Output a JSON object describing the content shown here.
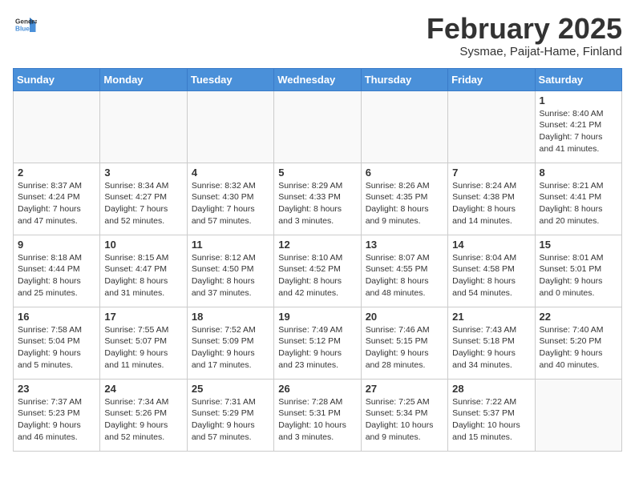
{
  "logo": {
    "general": "General",
    "blue": "Blue"
  },
  "header": {
    "title": "February 2025",
    "subtitle": "Sysmae, Paijat-Hame, Finland"
  },
  "weekdays": [
    "Sunday",
    "Monday",
    "Tuesday",
    "Wednesday",
    "Thursday",
    "Friday",
    "Saturday"
  ],
  "weeks": [
    [
      null,
      null,
      null,
      null,
      null,
      null,
      {
        "day": "1",
        "info": "Sunrise: 8:40 AM\nSunset: 4:21 PM\nDaylight: 7 hours and 41 minutes."
      }
    ],
    [
      {
        "day": "2",
        "info": "Sunrise: 8:37 AM\nSunset: 4:24 PM\nDaylight: 7 hours and 47 minutes."
      },
      {
        "day": "3",
        "info": "Sunrise: 8:34 AM\nSunset: 4:27 PM\nDaylight: 7 hours and 52 minutes."
      },
      {
        "day": "4",
        "info": "Sunrise: 8:32 AM\nSunset: 4:30 PM\nDaylight: 7 hours and 57 minutes."
      },
      {
        "day": "5",
        "info": "Sunrise: 8:29 AM\nSunset: 4:33 PM\nDaylight: 8 hours and 3 minutes."
      },
      {
        "day": "6",
        "info": "Sunrise: 8:26 AM\nSunset: 4:35 PM\nDaylight: 8 hours and 9 minutes."
      },
      {
        "day": "7",
        "info": "Sunrise: 8:24 AM\nSunset: 4:38 PM\nDaylight: 8 hours and 14 minutes."
      },
      {
        "day": "8",
        "info": "Sunrise: 8:21 AM\nSunset: 4:41 PM\nDaylight: 8 hours and 20 minutes."
      }
    ],
    [
      {
        "day": "9",
        "info": "Sunrise: 8:18 AM\nSunset: 4:44 PM\nDaylight: 8 hours and 25 minutes."
      },
      {
        "day": "10",
        "info": "Sunrise: 8:15 AM\nSunset: 4:47 PM\nDaylight: 8 hours and 31 minutes."
      },
      {
        "day": "11",
        "info": "Sunrise: 8:12 AM\nSunset: 4:50 PM\nDaylight: 8 hours and 37 minutes."
      },
      {
        "day": "12",
        "info": "Sunrise: 8:10 AM\nSunset: 4:52 PM\nDaylight: 8 hours and 42 minutes."
      },
      {
        "day": "13",
        "info": "Sunrise: 8:07 AM\nSunset: 4:55 PM\nDaylight: 8 hours and 48 minutes."
      },
      {
        "day": "14",
        "info": "Sunrise: 8:04 AM\nSunset: 4:58 PM\nDaylight: 8 hours and 54 minutes."
      },
      {
        "day": "15",
        "info": "Sunrise: 8:01 AM\nSunset: 5:01 PM\nDaylight: 9 hours and 0 minutes."
      }
    ],
    [
      {
        "day": "16",
        "info": "Sunrise: 7:58 AM\nSunset: 5:04 PM\nDaylight: 9 hours and 5 minutes."
      },
      {
        "day": "17",
        "info": "Sunrise: 7:55 AM\nSunset: 5:07 PM\nDaylight: 9 hours and 11 minutes."
      },
      {
        "day": "18",
        "info": "Sunrise: 7:52 AM\nSunset: 5:09 PM\nDaylight: 9 hours and 17 minutes."
      },
      {
        "day": "19",
        "info": "Sunrise: 7:49 AM\nSunset: 5:12 PM\nDaylight: 9 hours and 23 minutes."
      },
      {
        "day": "20",
        "info": "Sunrise: 7:46 AM\nSunset: 5:15 PM\nDaylight: 9 hours and 28 minutes."
      },
      {
        "day": "21",
        "info": "Sunrise: 7:43 AM\nSunset: 5:18 PM\nDaylight: 9 hours and 34 minutes."
      },
      {
        "day": "22",
        "info": "Sunrise: 7:40 AM\nSunset: 5:20 PM\nDaylight: 9 hours and 40 minutes."
      }
    ],
    [
      {
        "day": "23",
        "info": "Sunrise: 7:37 AM\nSunset: 5:23 PM\nDaylight: 9 hours and 46 minutes."
      },
      {
        "day": "24",
        "info": "Sunrise: 7:34 AM\nSunset: 5:26 PM\nDaylight: 9 hours and 52 minutes."
      },
      {
        "day": "25",
        "info": "Sunrise: 7:31 AM\nSunset: 5:29 PM\nDaylight: 9 hours and 57 minutes."
      },
      {
        "day": "26",
        "info": "Sunrise: 7:28 AM\nSunset: 5:31 PM\nDaylight: 10 hours and 3 minutes."
      },
      {
        "day": "27",
        "info": "Sunrise: 7:25 AM\nSunset: 5:34 PM\nDaylight: 10 hours and 9 minutes."
      },
      {
        "day": "28",
        "info": "Sunrise: 7:22 AM\nSunset: 5:37 PM\nDaylight: 10 hours and 15 minutes."
      },
      null
    ]
  ]
}
